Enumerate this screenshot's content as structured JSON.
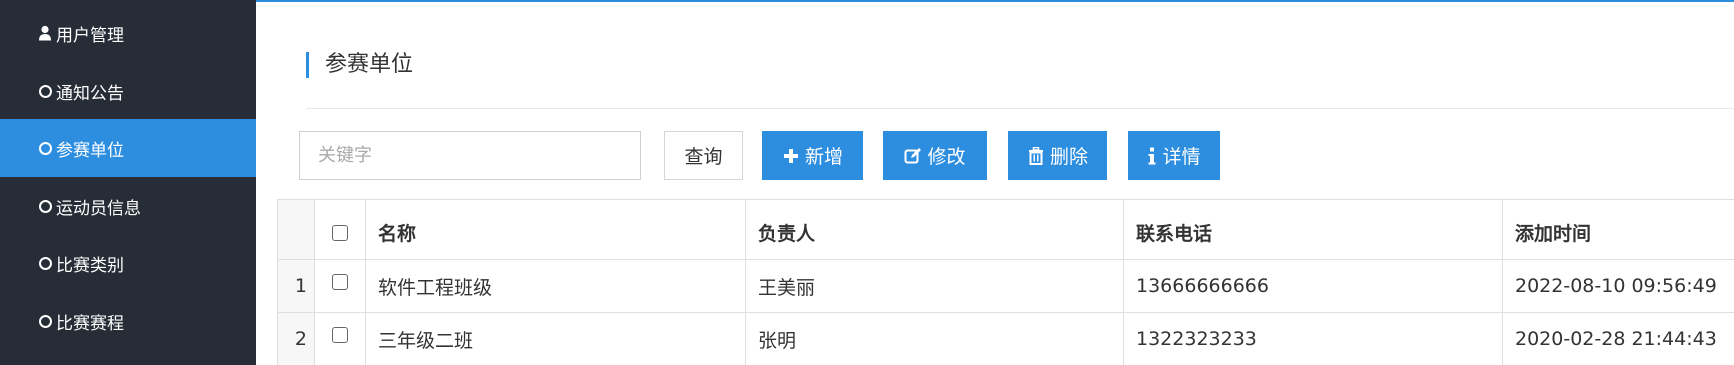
{
  "sidebar": {
    "items": [
      {
        "label": "用户管理",
        "icon": "user-icon",
        "active": false
      },
      {
        "label": "通知公告",
        "icon": "circle-icon",
        "active": false
      },
      {
        "label": "参赛单位",
        "icon": "circle-icon",
        "active": true
      },
      {
        "label": "运动员信息",
        "icon": "circle-icon",
        "active": false
      },
      {
        "label": "比赛类别",
        "icon": "circle-icon",
        "active": false
      },
      {
        "label": "比赛赛程",
        "icon": "circle-icon",
        "active": false
      }
    ]
  },
  "main": {
    "title": "参赛单位",
    "search": {
      "placeholder": "关键字",
      "value": ""
    },
    "buttons": {
      "query": "查询",
      "add": "新增",
      "edit": "修改",
      "delete": "删除",
      "detail": "详情"
    },
    "table": {
      "columns": [
        "名称",
        "负责人",
        "联系电话",
        "添加时间"
      ],
      "rows": [
        {
          "index": "1",
          "name": "软件工程班级",
          "owner": "王美丽",
          "phone": "13666666666",
          "time": "2022-08-10 09:56:49"
        },
        {
          "index": "2",
          "name": "三年级二班",
          "owner": "张明",
          "phone": "1322323233",
          "time": "2020-02-28 21:44:43"
        }
      ]
    }
  },
  "colors": {
    "sidebar_bg": "#262d37",
    "accent": "#2d8ee0",
    "text": "#333333"
  }
}
